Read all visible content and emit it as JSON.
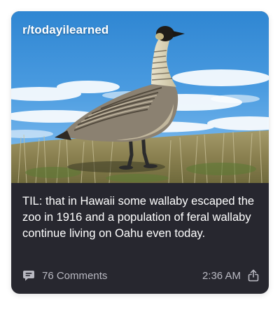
{
  "post": {
    "subreddit": "r/todayilearned",
    "title": "TIL: that in Hawaii some wallaby escaped the zoo in 1916 and a population of feral wallaby continue living on Oahu even today.",
    "comments_label": "76 Comments",
    "time": "2:36 AM"
  },
  "icons": {
    "comments": "comment-bubble-icon",
    "share": "share-icon"
  },
  "colors": {
    "card_background": "#27272f",
    "title_text": "#ffffff",
    "meta_text": "#b9b9c2"
  }
}
